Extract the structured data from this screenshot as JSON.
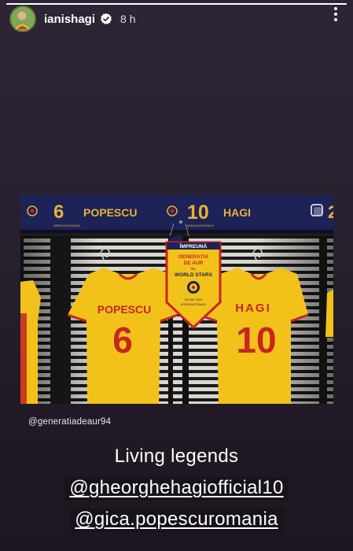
{
  "story": {
    "progress": 1.0,
    "username": "ianishagi",
    "time": "8 h",
    "more_icon": "more-vertical-icon",
    "verified_icon": "verified-badge-icon"
  },
  "photo": {
    "banner_left_number": "6",
    "banner_left_name": "POPESCU",
    "banner_right_number": "10",
    "banner_right_name": "HAGI",
    "banner_subtitle": "ARENA NAȚIONALĂ",
    "jersey_left_name": "POPESCU",
    "jersey_left_number": "6",
    "jersey_right_name": "HAGI",
    "jersey_right_number": "10",
    "pennant_top": "ÎMPREUNĂ",
    "pennant_line1": "GENERAȚIA",
    "pennant_line2": "DE AUR",
    "pennant_vs": "vs.",
    "pennant_line3": "WORLD STARS",
    "pennant_date": "29 MAI 2024",
    "pennant_venue": "ARENA NAȚIONALĂ"
  },
  "credit_handle": "@generatiadeaur94",
  "caption": {
    "line1": "Living legends",
    "mention1": "@gheorghehagiofficial10",
    "mention2": "@gica.popescuromania"
  },
  "colors": {
    "jersey_yellow": "#f2c21b",
    "jersey_red": "#c8251f",
    "banner_navy": "#1d2257",
    "banner_gold": "#e8b233"
  }
}
